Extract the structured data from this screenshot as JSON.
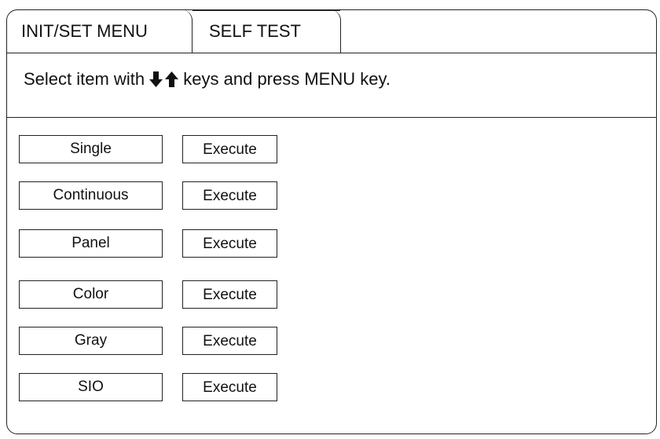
{
  "tabs": [
    {
      "label": "INIT/SET MENU"
    },
    {
      "label": "SELF TEST"
    }
  ],
  "instruction": {
    "prefix": "Select item with ",
    "down_icon": "arrow-down-icon",
    "up_icon": "arrow-up-icon",
    "suffix": " keys and press MENU key."
  },
  "tests": [
    {
      "label": "Single",
      "action": "Execute"
    },
    {
      "label": "Continuous",
      "action": "Execute"
    },
    {
      "label": "Panel",
      "action": "Execute"
    },
    {
      "label": "Color",
      "action": "Execute"
    },
    {
      "label": "Gray",
      "action": "Execute"
    },
    {
      "label": "SIO",
      "action": "Execute"
    }
  ]
}
